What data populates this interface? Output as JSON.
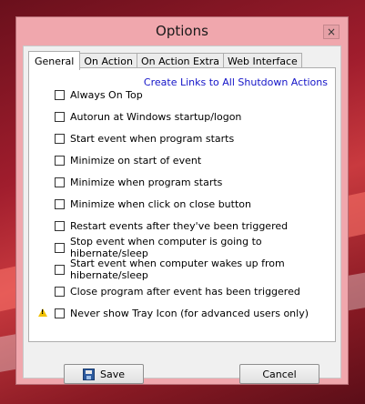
{
  "window": {
    "title": "Options",
    "close_symbol": "×"
  },
  "tabs": [
    {
      "label": "General",
      "active": true
    },
    {
      "label": "On Action",
      "active": false
    },
    {
      "label": "On Action Extra",
      "active": false
    },
    {
      "label": "Web Interface",
      "active": false
    }
  ],
  "general": {
    "link": "Create Links to All Shutdown Actions",
    "options": [
      {
        "label": "Always On Top",
        "checked": false
      },
      {
        "label": "Autorun at Windows startup/logon",
        "checked": false
      },
      {
        "label": "Start event when program starts",
        "checked": false
      },
      {
        "label": "Minimize on start of event",
        "checked": false
      },
      {
        "label": "Minimize when program starts",
        "checked": false
      },
      {
        "label": "Minimize when click on close button",
        "checked": false
      },
      {
        "label": "Restart events after they've been triggered",
        "checked": false
      },
      {
        "label": "Stop event when computer is going to hibernate/sleep",
        "checked": false
      },
      {
        "label": "Start event when computer wakes up from hibernate/sleep",
        "checked": false
      },
      {
        "label": "Close program after event has been triggered",
        "checked": false
      },
      {
        "label": "Never show Tray Icon (for advanced users only)",
        "checked": false,
        "warning_icon": "warning-triangle-icon"
      }
    ]
  },
  "buttons": {
    "save": "Save",
    "cancel": "Cancel"
  },
  "colors": {
    "link": "#1414c8",
    "title_bar": "#f0a7ad",
    "warning": "#f2c200"
  }
}
